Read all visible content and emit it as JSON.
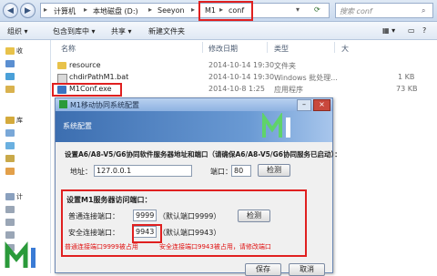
{
  "explorer": {
    "breadcrumb": [
      "计算机",
      "本地磁盘 (D:)",
      "Seeyon",
      "M1",
      "conf"
    ],
    "search_placeholder": "搜索 conf",
    "toolbar": {
      "organize": "组织 ▾",
      "include": "包含到库中 ▾",
      "share": "共享 ▾",
      "new_folder": "新建文件夹"
    },
    "sidebar": {
      "favorites": "收",
      "library": "库",
      "computer": "计"
    },
    "columns": {
      "name": "名称",
      "modified": "修改日期",
      "type": "类型",
      "size": "大"
    },
    "files": [
      {
        "name": "resource",
        "modified": "2014-10-14 19:30",
        "type": "文件夹",
        "size": ""
      },
      {
        "name": "chdirPathM1.bat",
        "modified": "2014-10-14 19:30",
        "type": "Windows 批处理...",
        "size": "1 KB"
      },
      {
        "name": "M1Conf.exe",
        "modified": "2014-10-8 1:25",
        "type": "应用程序",
        "size": "73 KB"
      }
    ]
  },
  "dialog": {
    "title": "M1移动协同系统配置",
    "banner": "系统配置",
    "section1_title": "设置A6/A8-V5/G6协同软件服务器地址和端口（请确保A6/A8-V5/G6协同服务已启动）：",
    "address_label": "地址：",
    "address_value": "127.0.0.1",
    "port_label": "端口：",
    "port_value": "80",
    "detect_label": "检测",
    "section2_title": "设置M1服务器访问端口：",
    "normal_port_label": "普通连接端口：",
    "normal_port_value": "9999",
    "normal_port_default": "（默认端口9999）",
    "secure_port_label": "安全连接端口：",
    "secure_port_value": "9943",
    "secure_port_default": "（默认端口9943）",
    "detect2_label": "检测",
    "warning_normal": "普通连接端口9999被占用",
    "warning_secure": "安全连接端口9943被占用，请修改端口",
    "save_label": "保存",
    "cancel_label": "取消"
  },
  "colors": {
    "highlight": "#e02020",
    "warning_text": "#e01010",
    "banner": "#3c6eb0"
  }
}
